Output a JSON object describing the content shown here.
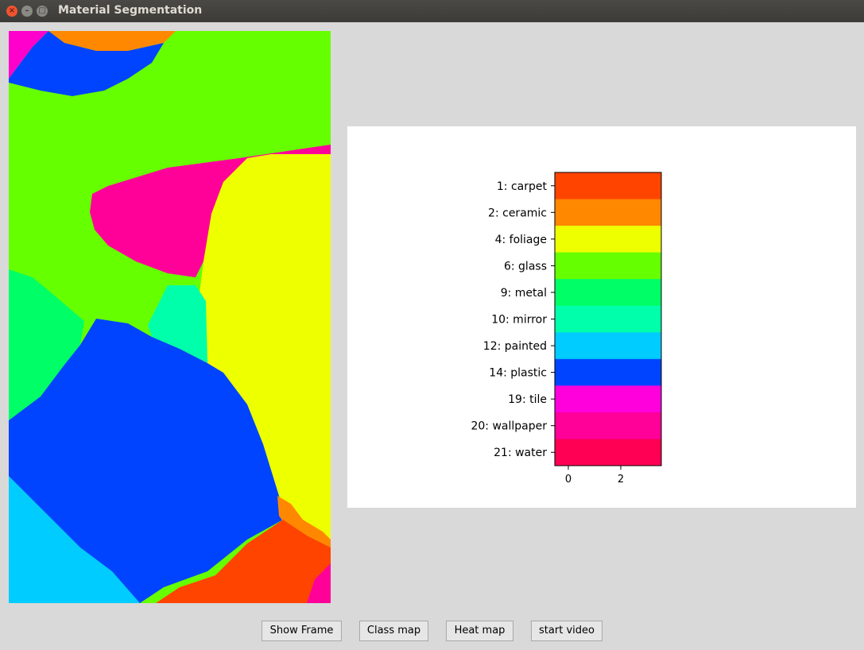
{
  "window": {
    "title": "Material Segmentation",
    "buttons": [
      "close-icon",
      "minimize-icon",
      "maximize-icon"
    ]
  },
  "segmentation_image": {
    "description_colors": [
      "#ff00cc",
      "#ff8800",
      "#0044ff",
      "#66ff00",
      "#ff0099",
      "#eeff00",
      "#00ff99",
      "#00ffaa",
      "#00ccff",
      "#ff4400"
    ]
  },
  "legend": {
    "classes": [
      {
        "label": "1: carpet",
        "color": "#ff4400"
      },
      {
        "label": "2: ceramic",
        "color": "#ff8800"
      },
      {
        "label": "4: foliage",
        "color": "#eeff00"
      },
      {
        "label": "6: glass",
        "color": "#66ff00"
      },
      {
        "label": "9: metal",
        "color": "#00ff66"
      },
      {
        "label": "10: mirror",
        "color": "#00ffaa"
      },
      {
        "label": "12: painted",
        "color": "#00ccff"
      },
      {
        "label": "14: plastic",
        "color": "#0044ff"
      },
      {
        "label": "19: tile",
        "color": "#ff00dd"
      },
      {
        "label": "20: wallpaper",
        "color": "#ff0099"
      },
      {
        "label": "21: water",
        "color": "#ff0055"
      }
    ],
    "x_ticks": [
      "0",
      "2"
    ]
  },
  "toolbar": {
    "show_frame": "Show Frame",
    "class_map": "Class map",
    "heat_map": "Heat map",
    "start_video": "start video"
  }
}
